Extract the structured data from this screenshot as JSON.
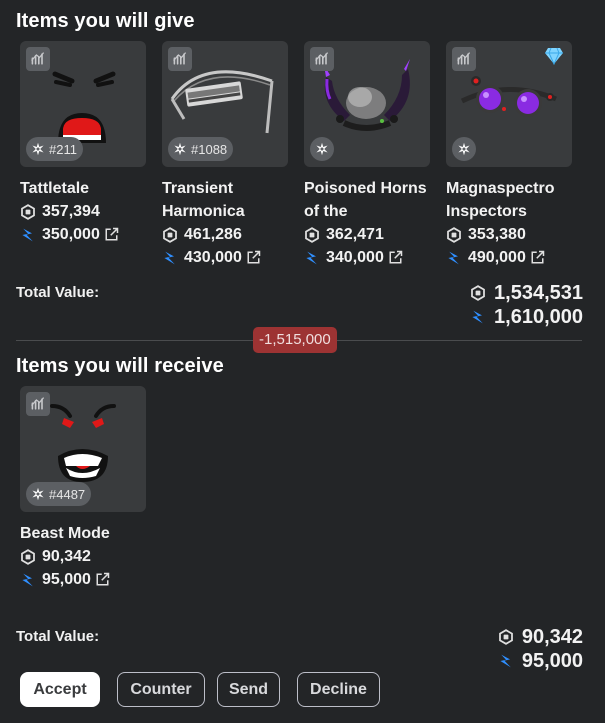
{
  "give": {
    "title": "Items you will give",
    "items": [
      {
        "name": "Tattletale",
        "serial": "#211",
        "robux": "357,394",
        "value": "350,000"
      },
      {
        "name": "Transient Harmonica",
        "serial": "#1088",
        "robux": "461,286",
        "value": "430,000"
      },
      {
        "name": "Poisoned Horns of the",
        "robux": "362,471",
        "value": "340,000"
      },
      {
        "name": "Magnaspectro Inspectors",
        "robux": "353,380",
        "value": "490,000"
      }
    ],
    "total_label": "Total Value:",
    "total_robux": "1,534,531",
    "total_value": "1,610,000"
  },
  "difference": "-1,515,000",
  "receive": {
    "title": "Items you will receive",
    "items": [
      {
        "name": "Beast Mode",
        "serial": "#4487",
        "robux": "90,342",
        "value": "95,000"
      }
    ],
    "total_label": "Total Value:",
    "total_robux": "90,342",
    "total_value": "95,000"
  },
  "actions": {
    "accept": "Accept",
    "counter": "Counter",
    "send": "Send",
    "decline": "Decline"
  },
  "colors": {
    "background": "#232527",
    "card": "#393b3d",
    "value_accent": "#2f8fff",
    "difference_badge": "#9d3333"
  },
  "icons": {
    "restricted": "chart-icon",
    "serial": "sparkle-icon",
    "robux": "robux-icon",
    "value": "value-z-icon",
    "external": "external-link-icon",
    "projected": "diamond-icon"
  }
}
